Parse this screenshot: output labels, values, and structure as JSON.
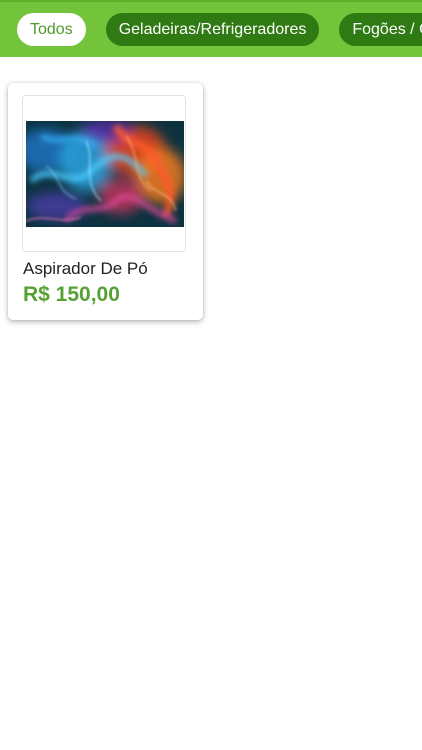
{
  "categories": [
    {
      "label": "Todos",
      "active": true
    },
    {
      "label": "Geladeiras/Refrigeradores",
      "active": false
    },
    {
      "label": "Fogões / Coo",
      "active": false
    }
  ],
  "products": [
    {
      "name": "Aspirador De Pó",
      "price": "R$ 150,00",
      "image_icon": "colorful-smoke-photo"
    }
  ],
  "colors": {
    "topbar": "#73c43b",
    "chip_active_bg": "#ffffff",
    "chip_active_text": "#4e9a2b",
    "chip_inactive_bg": "#2f7a12",
    "price": "#55a133"
  }
}
